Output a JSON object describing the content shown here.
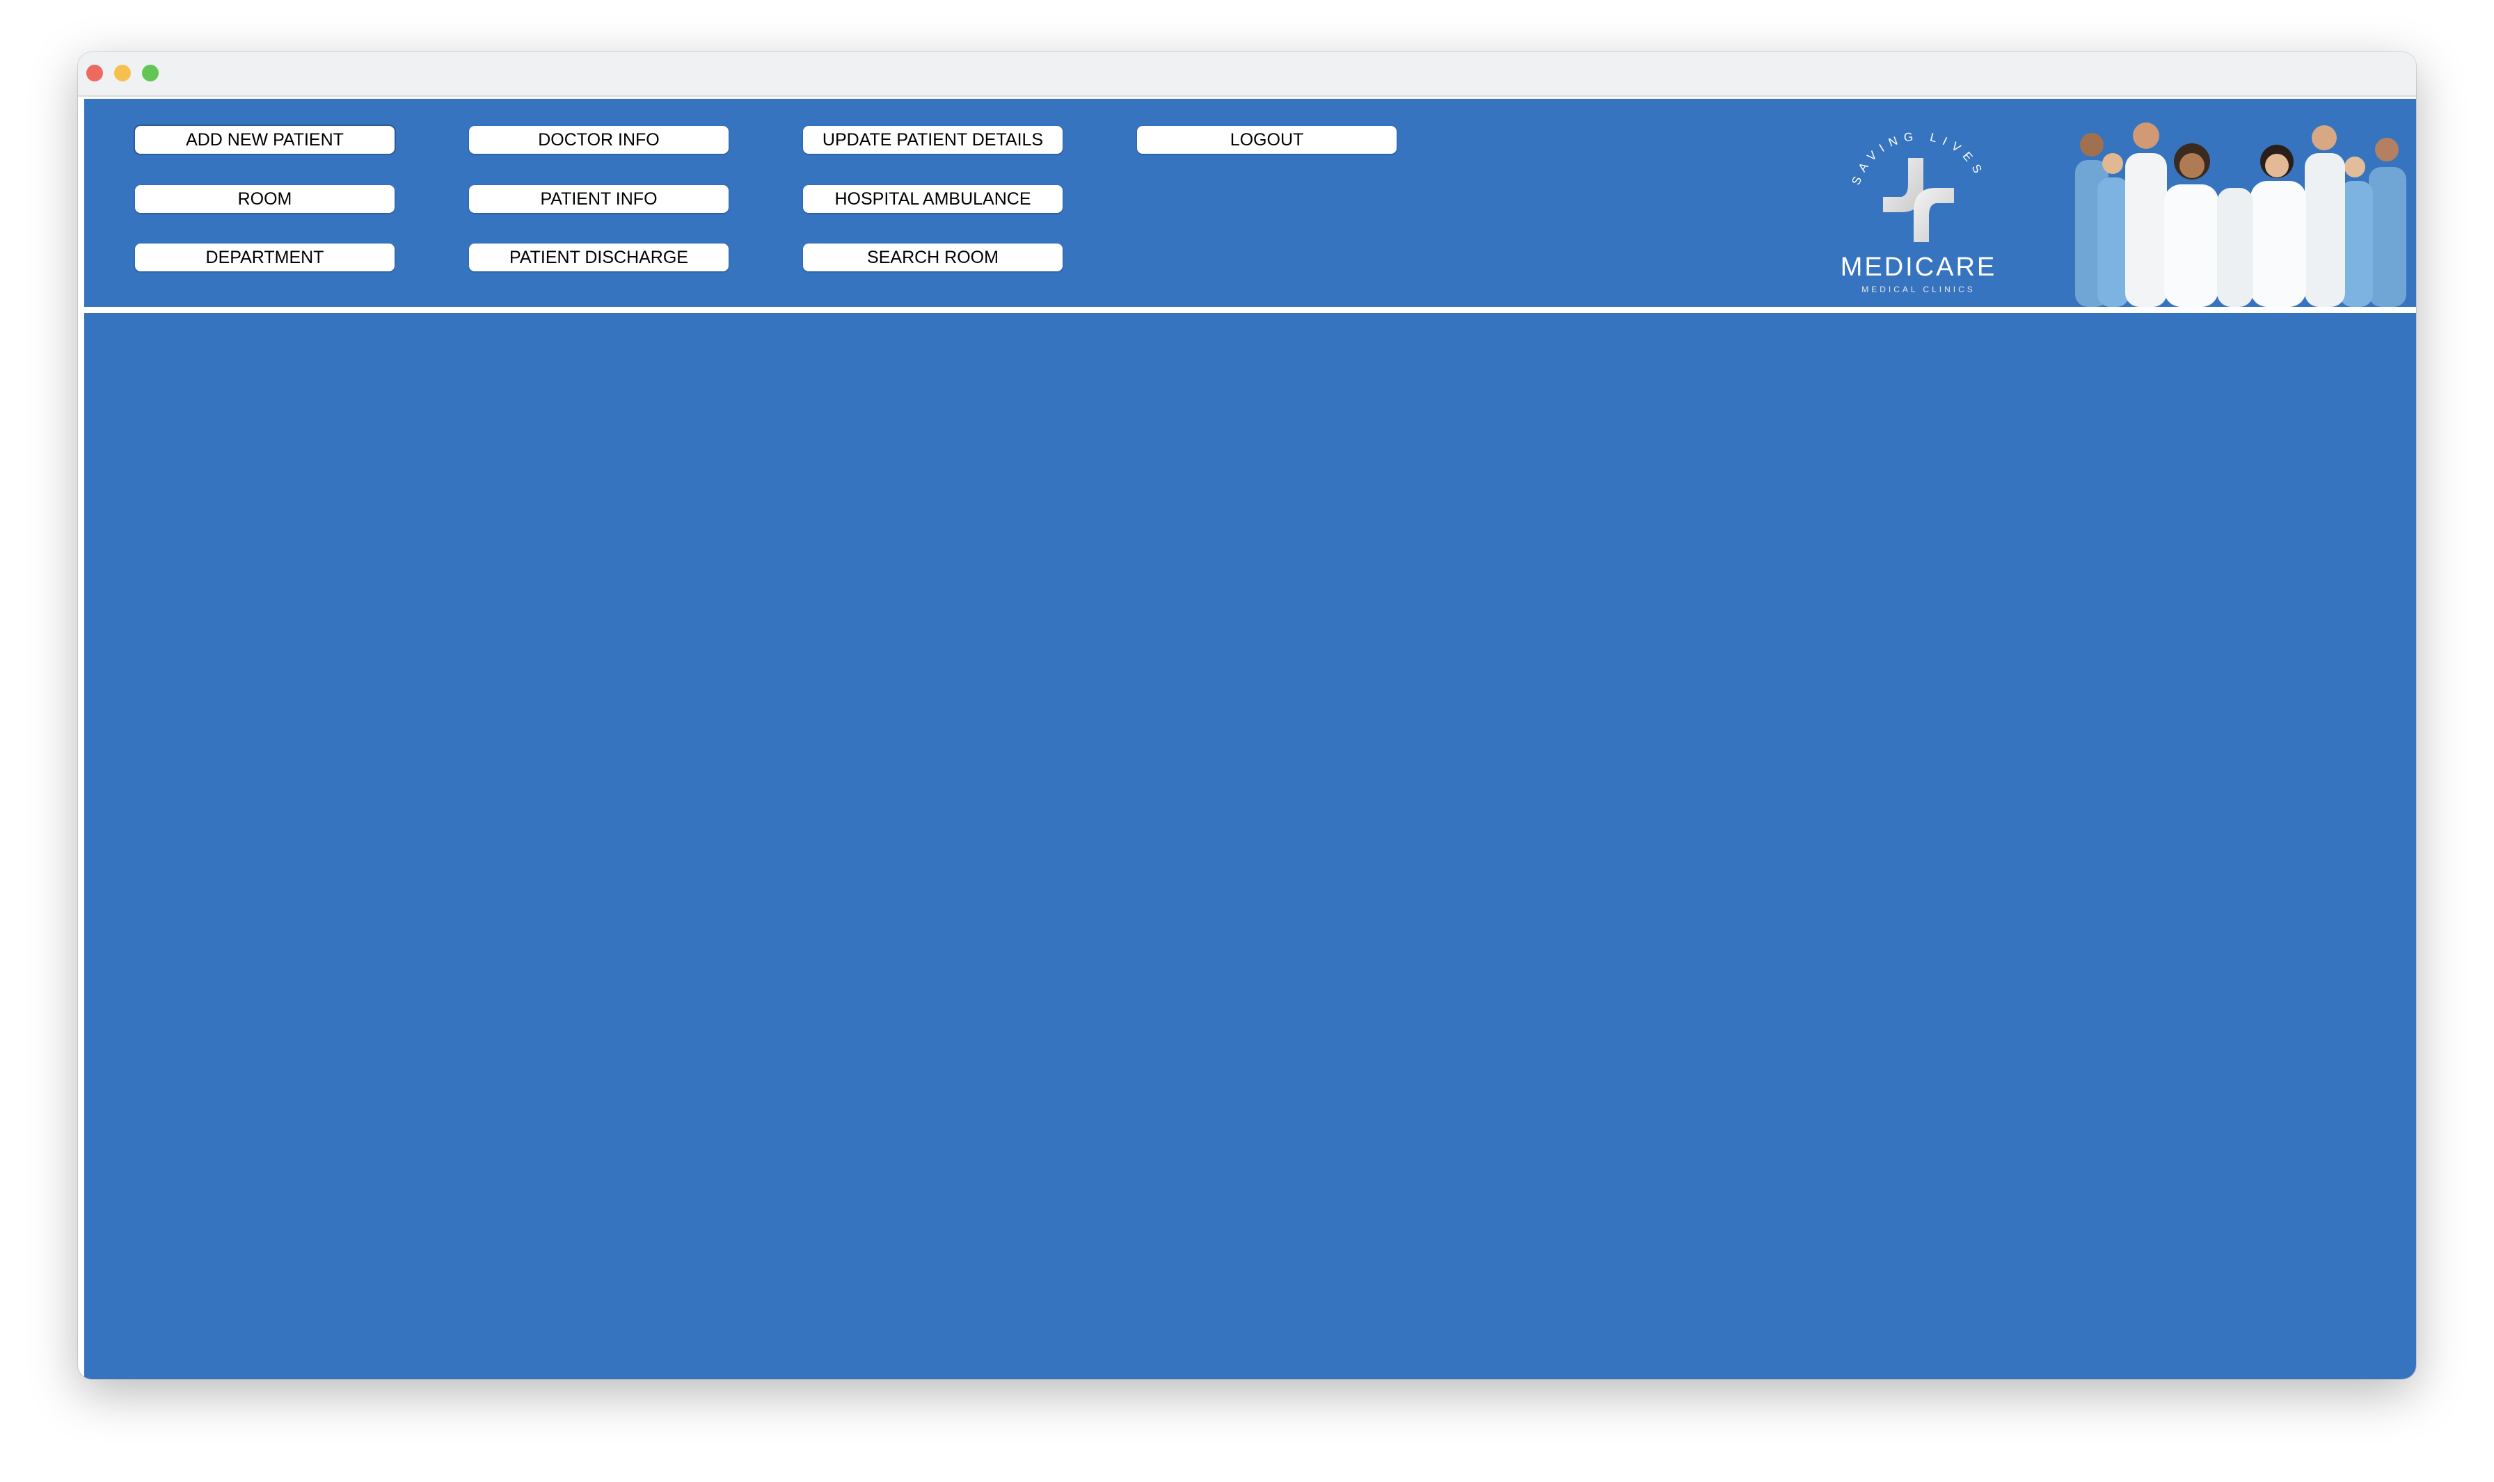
{
  "window": {
    "controls": [
      "close",
      "minimize",
      "zoom"
    ]
  },
  "menu": {
    "buttons": [
      {
        "label": "ADD NEW PATIENT"
      },
      {
        "label": "DOCTOR INFO"
      },
      {
        "label": "UPDATE PATIENT DETAILS"
      },
      {
        "label": "LOGOUT"
      },
      {
        "label": "ROOM"
      },
      {
        "label": "PATIENT INFO"
      },
      {
        "label": "HOSPITAL AMBULANCE"
      },
      {
        "label": "DEPARTMENT"
      },
      {
        "label": "PATIENT DISCHARGE"
      },
      {
        "label": "SEARCH ROOM"
      }
    ]
  },
  "logo": {
    "tagline": "SAVING LIVES",
    "name": "MEDICARE",
    "subtitle": "MEDICAL CLINICS",
    "icon": "medical-cross-icon"
  },
  "colors": {
    "background": "#3674c0",
    "button": "#ffffff",
    "close": "#ee6a5f",
    "minimize": "#f5c04f",
    "zoom": "#62c554"
  }
}
